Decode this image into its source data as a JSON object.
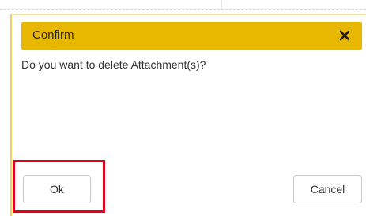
{
  "dialog": {
    "title": "Confirm",
    "close_icon": "close-icon",
    "message": "Do you want to delete Attachment(s)?",
    "ok_label": "Ok",
    "cancel_label": "Cancel"
  },
  "colors": {
    "title_bar": "#e8b800",
    "highlight": "#e0001b"
  }
}
